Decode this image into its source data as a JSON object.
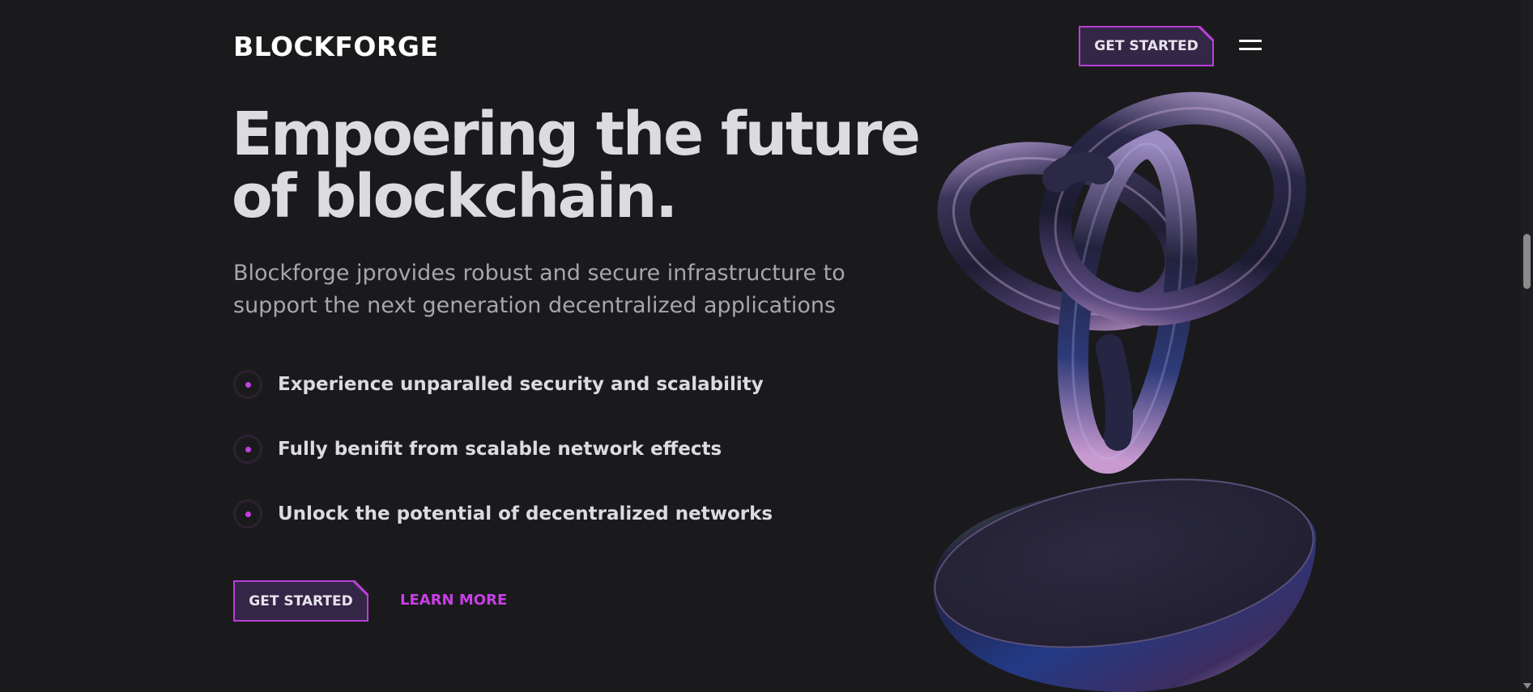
{
  "header": {
    "logo": "BLOCKFORGE",
    "cta_label": "GET STARTED",
    "menu_icon": "hamburger-menu-icon"
  },
  "hero": {
    "headline_line1": "Empoering the future",
    "headline_line2": "of blockchain.",
    "subtitle_line1": "Blockforge jprovides robust and secure infrastructure to",
    "subtitle_line2": "support the next generation decentralized applications",
    "features": [
      {
        "label": "Experience unparalled security and scalability"
      },
      {
        "label": "Fully benifit from scalable network effects"
      },
      {
        "label": "Unlock the potential of decentralized networks"
      }
    ],
    "primary_cta": "GET STARTED",
    "secondary_cta": "LEARN MORE"
  },
  "colors": {
    "background": "#1a1a1c",
    "accent": "#c93fe6",
    "button_fill": "#342646",
    "headline": "#dcdbe0",
    "subtitle": "#a7a5ad"
  },
  "illustration": "3d-glossy-knot-and-bowl"
}
